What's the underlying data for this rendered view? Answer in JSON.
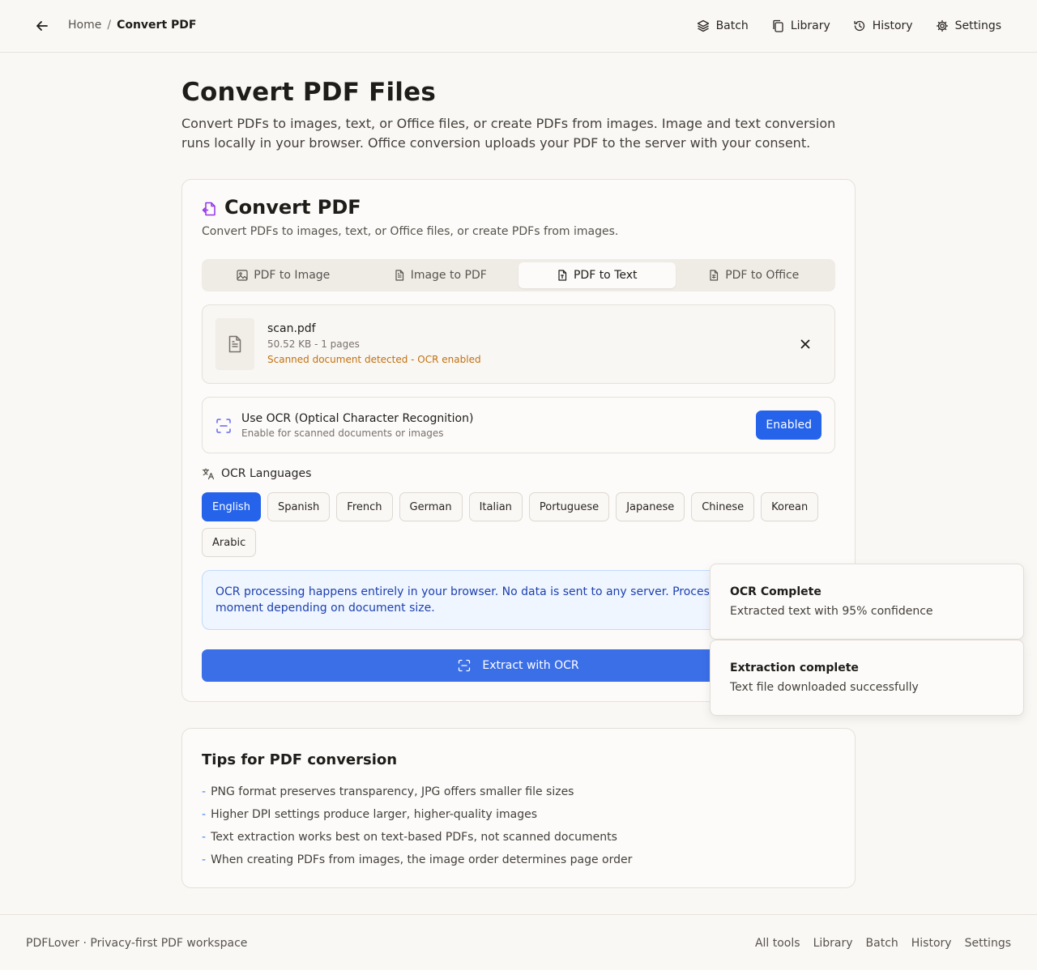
{
  "header": {
    "breadcrumb": {
      "home": "Home",
      "separator": "/",
      "current": "Convert PDF"
    },
    "nav": [
      {
        "label": "Batch",
        "icon": "layers-icon"
      },
      {
        "label": "Library",
        "icon": "copy-icon"
      },
      {
        "label": "History",
        "icon": "history-icon"
      },
      {
        "label": "Settings",
        "icon": "gear-icon"
      }
    ]
  },
  "page": {
    "title": "Convert PDF Files",
    "description": "Convert PDFs to images, text, or Office files, or create PDFs from images. Image and text conversion runs locally in your browser. Office conversion uploads your PDF to the server with your consent."
  },
  "converter": {
    "title": "Convert PDF",
    "description": "Convert PDFs to images, text, or Office files, or create PDFs from images.",
    "tabs": [
      {
        "label": "PDF to Image",
        "icon": "image-icon"
      },
      {
        "label": "Image to PDF",
        "icon": "file-text-icon"
      },
      {
        "label": "PDF to Text",
        "icon": "file-type-icon",
        "active": true
      },
      {
        "label": "PDF to Office",
        "icon": "file-spreadsheet-icon"
      }
    ],
    "file": {
      "name": "scan.pdf",
      "meta": "50.52 KB - 1 pages",
      "warning": "Scanned document detected - OCR enabled"
    },
    "ocr": {
      "title": "Use OCR (Optical Character Recognition)",
      "subtitle": "Enable for scanned documents or images",
      "button": "Enabled"
    },
    "languages": {
      "label": "OCR Languages",
      "items": [
        "English",
        "Spanish",
        "French",
        "German",
        "Italian",
        "Portuguese",
        "Japanese",
        "Chinese",
        "Korean",
        "Arabic"
      ],
      "selected": "English"
    },
    "info": "OCR processing happens entirely in your browser. No data is sent to any server. Processing may take a moment depending on document size.",
    "action": "Extract with OCR"
  },
  "tips": {
    "title": "Tips for PDF conversion",
    "items": [
      "PNG format preserves transparency, JPG offers smaller file sizes",
      "Higher DPI settings produce larger, higher-quality images",
      "Text extraction works best on text-based PDFs, not scanned documents",
      "When creating PDFs from images, the image order determines page order"
    ]
  },
  "toasts": [
    {
      "title": "OCR Complete",
      "description": "Extracted text with 95% confidence"
    },
    {
      "title": "Extraction complete",
      "description": "Text file downloaded successfully"
    }
  ],
  "footer": {
    "brand": "PDFLover · Privacy-first PDF workspace",
    "links": [
      "All tools",
      "Library",
      "Batch",
      "History",
      "Settings"
    ]
  },
  "colors": {
    "accent": "#2563eb",
    "warning": "#c2700e",
    "info_text": "#1e40af",
    "background": "#faf8f5"
  }
}
